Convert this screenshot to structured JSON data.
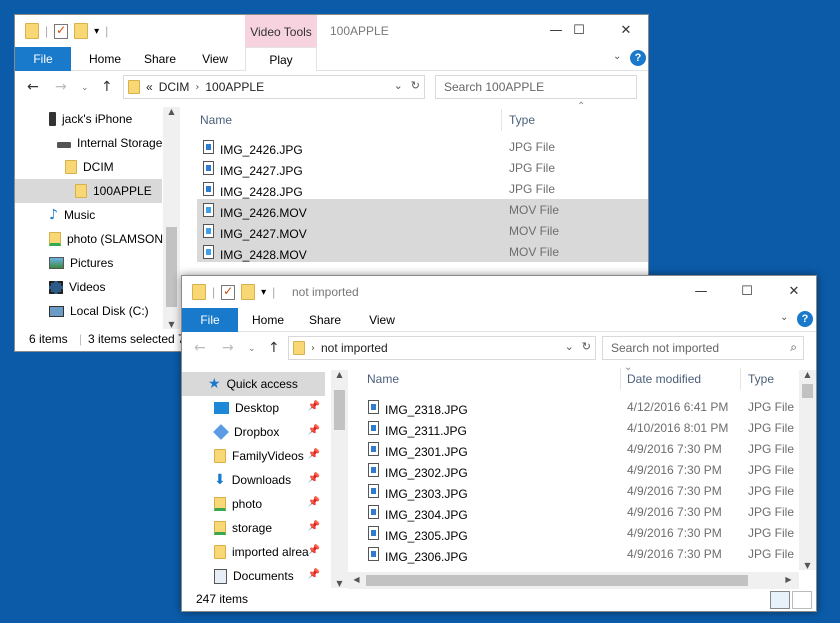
{
  "window1": {
    "title": "100APPLE",
    "contextual_tab": "Video Tools",
    "tabs": {
      "file": "File",
      "home": "Home",
      "share": "Share",
      "view": "View",
      "play": "Play"
    },
    "address": {
      "overflow": "«",
      "crumbs": [
        "DCIM",
        "100APPLE"
      ]
    },
    "search_placeholder": "Search 100APPLE",
    "nav": [
      {
        "label": "jack's iPhone",
        "icon": "phone-icon"
      },
      {
        "label": "Internal Storage",
        "icon": "drive-icon"
      },
      {
        "label": "DCIM",
        "icon": "folder-icon"
      },
      {
        "label": "100APPLE",
        "icon": "folder-icon"
      },
      {
        "label": "Music",
        "icon": "music-icon"
      },
      {
        "label": "photo (SLAMSON",
        "icon": "folder-icon"
      },
      {
        "label": "Pictures",
        "icon": "pictures-icon"
      },
      {
        "label": "Videos",
        "icon": "videos-icon"
      },
      {
        "label": "Local Disk (C:)",
        "icon": "disk-icon"
      }
    ],
    "columns": {
      "name": "Name",
      "type": "Type"
    },
    "files": [
      {
        "name": "IMG_2426.JPG",
        "type": "JPG File"
      },
      {
        "name": "IMG_2427.JPG",
        "type": "JPG File"
      },
      {
        "name": "IMG_2428.JPG",
        "type": "JPG File"
      },
      {
        "name": "IMG_2426.MOV",
        "type": "MOV File"
      },
      {
        "name": "IMG_2427.MOV",
        "type": "MOV File"
      },
      {
        "name": "IMG_2428.MOV",
        "type": "MOV File"
      }
    ],
    "status": {
      "count": "6 items",
      "selected": "3 items selected 7"
    }
  },
  "window2": {
    "title": "not imported",
    "tabs": {
      "file": "File",
      "home": "Home",
      "share": "Share",
      "view": "View"
    },
    "address": {
      "crumbs": [
        "not imported"
      ]
    },
    "search_placeholder": "Search not imported",
    "nav": [
      {
        "label": "Quick access",
        "icon": "star-icon"
      },
      {
        "label": "Desktop",
        "icon": "desktop-icon"
      },
      {
        "label": "Dropbox",
        "icon": "dropbox-icon"
      },
      {
        "label": "FamilyVideos",
        "icon": "folder-icon"
      },
      {
        "label": "Downloads",
        "icon": "downloads-icon"
      },
      {
        "label": "photo",
        "icon": "folder-icon"
      },
      {
        "label": "storage",
        "icon": "folder-icon"
      },
      {
        "label": "imported alrea",
        "icon": "folder-icon"
      },
      {
        "label": "Documents",
        "icon": "documents-icon"
      }
    ],
    "columns": {
      "name": "Name",
      "date": "Date modified",
      "type": "Type"
    },
    "files": [
      {
        "name": "IMG_2318.JPG",
        "date": "4/12/2016 6:41 PM",
        "type": "JPG File"
      },
      {
        "name": "IMG_2311.JPG",
        "date": "4/10/2016 8:01 PM",
        "type": "JPG File"
      },
      {
        "name": "IMG_2301.JPG",
        "date": "4/9/2016 7:30 PM",
        "type": "JPG File"
      },
      {
        "name": "IMG_2302.JPG",
        "date": "4/9/2016 7:30 PM",
        "type": "JPG File"
      },
      {
        "name": "IMG_2303.JPG",
        "date": "4/9/2016 7:30 PM",
        "type": "JPG File"
      },
      {
        "name": "IMG_2304.JPG",
        "date": "4/9/2016 7:30 PM",
        "type": "JPG File"
      },
      {
        "name": "IMG_2305.JPG",
        "date": "4/9/2016 7:30 PM",
        "type": "JPG File"
      },
      {
        "name": "IMG_2306.JPG",
        "date": "4/9/2016 7:30 PM",
        "type": "JPG File"
      }
    ],
    "status": {
      "count": "247 items"
    }
  },
  "colors": {
    "desktop": "#0b5ba8",
    "accent": "#1979ca",
    "video_tools": "#f7d3e0"
  }
}
